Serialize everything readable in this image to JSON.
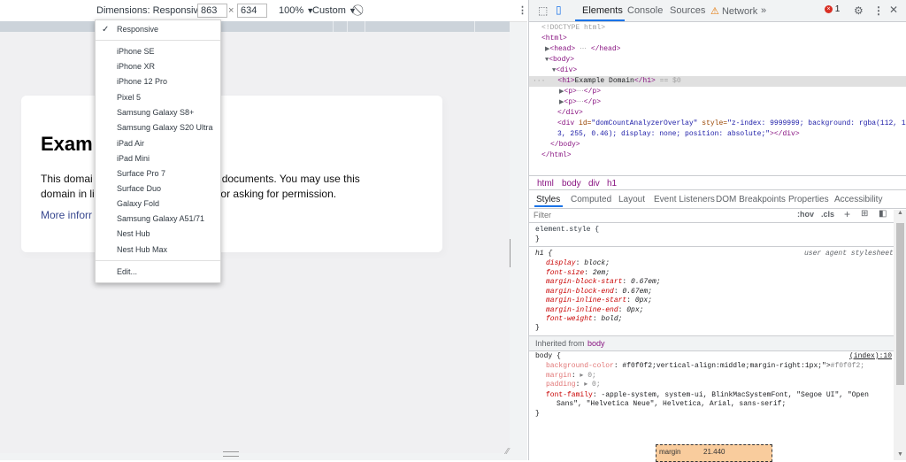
{
  "toolbar": {
    "dimensions_label": "Dimensions: Responsive",
    "width": "863",
    "times": "×",
    "height": "634",
    "zoom": "100%",
    "throttle": "Custom"
  },
  "device_menu": {
    "items": [
      "Responsive",
      "iPhone SE",
      "iPhone XR",
      "iPhone 12 Pro",
      "Pixel 5",
      "Samsung Galaxy S8+",
      "Samsung Galaxy S20 Ultra",
      "iPad Air",
      "iPad Mini",
      "Surface Pro 7",
      "Surface Duo",
      "Galaxy Fold",
      "Samsung Galaxy A51/71",
      "Nest Hub",
      "Nest Hub Max",
      "Edit..."
    ],
    "checked": "Responsive"
  },
  "page": {
    "heading": "Exam",
    "para_line1_left": "This domai",
    "para_line1_right": "mples in documents. You may use this",
    "para_line2_left": "domain in li",
    "para_line2_right": "ination or asking for permission.",
    "link": "More inforr"
  },
  "devtools": {
    "tabs": [
      "Elements",
      "Console",
      "Sources",
      "Network",
      "»"
    ],
    "active_tab": "Elements",
    "error_count": "1",
    "dom": {
      "doctype": "<!DOCTYPE html>",
      "html_open": "<html>",
      "head": "<head>",
      "head_close": "</head>",
      "body_open": "<body>",
      "div_open": "<div>",
      "h1_open": "<h1>",
      "h1_text": "Example Domain",
      "h1_close": "</h1>",
      "eq": "== $0",
      "p_open": "<p>",
      "p_close": "</p>",
      "div_close": "</div>",
      "overlay_div_start": "<div",
      "overlay_id_attr": "id=",
      "overlay_id_val": "\"domCountAnalyzerOverlay\"",
      "overlay_style_attr": "style=",
      "overlay_style_val1": "\"z-index: 9999999; background: rgba(112, 16",
      "overlay_style_val2": "3, 255, 0.46); display: none; position: absolute;\"",
      "overlay_close": "></div>",
      "body_close": "</body>",
      "html_close": "</html>",
      "ellipsis": "⋯",
      "row_dots": "···"
    },
    "breadcrumbs": [
      "html",
      "body",
      "div",
      "h1"
    ],
    "subtabs": [
      "Styles",
      "Computed",
      "Layout",
      "Event Listeners",
      "DOM Breakpoints",
      "Properties",
      "Accessibility"
    ],
    "filter_placeholder": "Filter",
    "hov": ":hov",
    "cls": ".cls",
    "styles": {
      "element_style": "element.style {",
      "close_brace": "}",
      "h1_selector": "h1 {",
      "ua_label": "user agent stylesheet",
      "h1_rules": [
        [
          "display",
          "block;"
        ],
        [
          "font-size",
          "2em;"
        ],
        [
          "margin-block-start",
          "0.67em;"
        ],
        [
          "margin-block-end",
          "0.67em;"
        ],
        [
          "margin-inline-start",
          "0px;"
        ],
        [
          "margin-inline-end",
          "0px;"
        ],
        [
          "font-weight",
          "bold;"
        ]
      ],
      "inherited_label": "Inherited from",
      "inherited_from": "body",
      "body_selector": "body {",
      "body_source": "(index):10",
      "body_rules": [
        [
          "background-color",
          "#f0f0f2;"
        ],
        [
          "margin",
          "▸ 0;"
        ],
        [
          "padding",
          "▸ 0;"
        ]
      ],
      "font_family_prop": "font-family",
      "font_family_val1": "-apple-system, system-ui, BlinkMacSystemFont, \"Segoe UI\", \"Open",
      "font_family_val2": "Sans\", \"Helvetica Neue\", Helvetica, Arial, sans-serif;"
    },
    "box_model": {
      "label": "margin",
      "value": "21.440"
    }
  },
  "colors": {
    "accent": "#1a73e8",
    "tag": "#881280",
    "error": "#d93025"
  }
}
